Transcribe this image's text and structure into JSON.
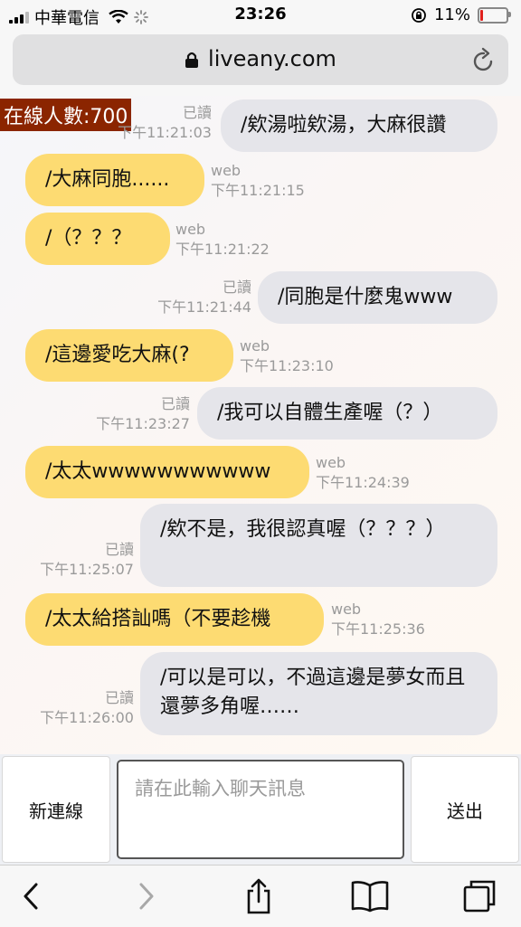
{
  "status_bar": {
    "carrier": "中華電信",
    "time": "23:26",
    "battery": "11%",
    "battery_level": 0.11
  },
  "browser": {
    "url": "liveany.com"
  },
  "chat": {
    "online_count": "在線人數:700",
    "messages": [
      {
        "side": "me",
        "text": "/欸湯啦欸湯，大麻很讚",
        "read": "已讀",
        "time": "下午11:21:03"
      },
      {
        "side": "them",
        "text": "/大麻同胞......",
        "source": "web",
        "time": "下午11:21:15"
      },
      {
        "side": "them",
        "text": "/（？？？",
        "source": "web",
        "time": "下午11:21:22"
      },
      {
        "side": "me",
        "text": "/同胞是什麼鬼www",
        "read": "已讀",
        "time": "下午11:21:44"
      },
      {
        "side": "them",
        "text": "/這邊愛吃大麻(?",
        "source": "web",
        "time": "下午11:23:10"
      },
      {
        "side": "me",
        "text": "/我可以自體生產喔（？）",
        "read": "已讀",
        "time": "下午11:23:27"
      },
      {
        "side": "them",
        "text": "/太太wwwwwwwwwww",
        "source": "web",
        "time": "下午11:24:39"
      },
      {
        "side": "me",
        "text": "/欸不是，我很認真喔（？？？）",
        "read": "已讀",
        "time": "下午11:25:07"
      },
      {
        "side": "them",
        "text": "/太太給搭訕嗎（不要趁機",
        "source": "web",
        "time": "下午11:25:36"
      },
      {
        "side": "me",
        "text": "/可以是可以，不過這邊是夢女而且還夢多角喔……",
        "read": "已讀",
        "time": "下午11:26:00"
      }
    ]
  },
  "input": {
    "new_connection_label": "新連線",
    "placeholder": "請在此輸入聊天訊息",
    "send_label": "送出"
  },
  "toolbar": {
    "icons": [
      "back-icon",
      "forward-icon",
      "share-icon",
      "bookmarks-icon",
      "tabs-icon"
    ]
  },
  "colors": {
    "my_bubble": "#e5e5ea",
    "their_bubble": "#fddb72",
    "online_badge": "#8b2500",
    "battery_low": "#e0201c"
  }
}
